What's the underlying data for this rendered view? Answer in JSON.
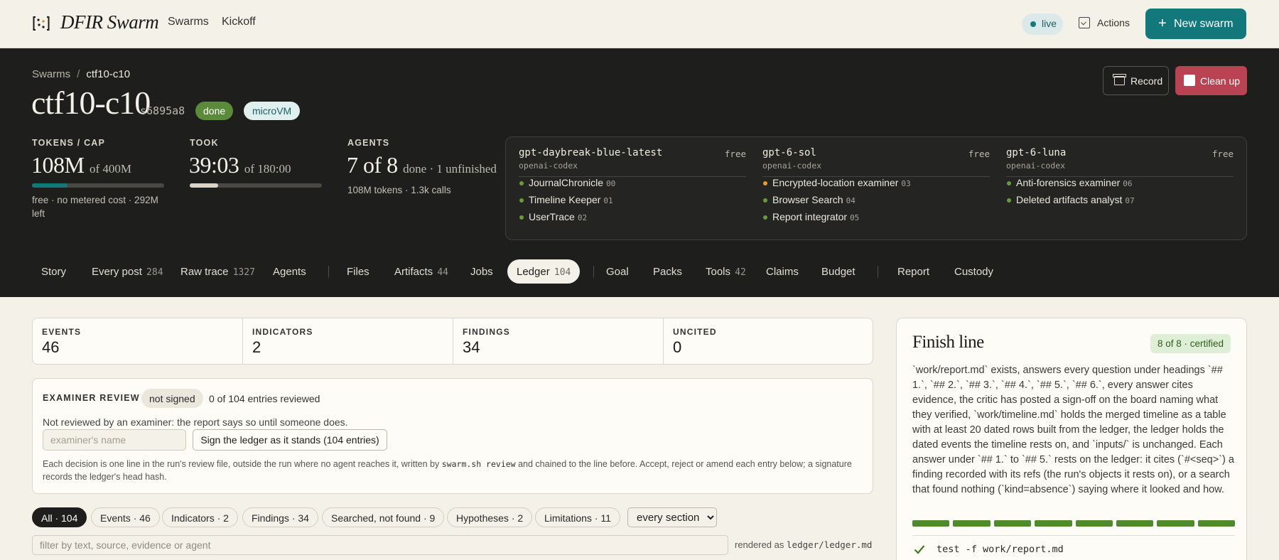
{
  "app": {
    "title": "DFIR Swarm",
    "nav": [
      "Swarms",
      "Kickoff"
    ],
    "status": "live",
    "actions_label": "Actions",
    "new_swarm_label": "New swarm",
    "accent_color": "#13787c"
  },
  "hero": {
    "breadcrumb": [
      "Swarms",
      "ctf10-c10"
    ],
    "title": "ctf10-c10",
    "id": "s6895a8",
    "badges": [
      "done",
      "microVM"
    ],
    "record_label": "Record",
    "cleanup_label": "Clean up",
    "stats": [
      {
        "label": "TOKENS / CAP",
        "value": "108M",
        "suffix": "of 400M",
        "progress": 0.27,
        "note": "free · no metered cost · 292M left"
      },
      {
        "label": "TOOK",
        "value": "39:03",
        "suffix": "of 180:00",
        "progress": 0.217
      },
      {
        "label": "AGENTS",
        "value": "7 of 8",
        "suffix": "done · 1 unfinished",
        "note": "108M tokens · 1.3k calls"
      }
    ],
    "models": [
      {
        "name": "gpt-daybreak-blue-latest",
        "provider": "openai-codex",
        "tier": "free",
        "agents": [
          {
            "name": "JournalChronicle",
            "num": "00",
            "status": "done"
          },
          {
            "name": "Timeline Keeper",
            "num": "01",
            "status": "done"
          },
          {
            "name": "UserTrace",
            "num": "02",
            "status": "done"
          }
        ]
      },
      {
        "name": "gpt-6-sol",
        "provider": "openai-codex",
        "tier": "free",
        "agents": [
          {
            "name": "Encrypted-location examiner",
            "num": "03",
            "status": "unfinished"
          },
          {
            "name": "Browser Search",
            "num": "04",
            "status": "done"
          },
          {
            "name": "Report integrator",
            "num": "05",
            "status": "done"
          }
        ]
      },
      {
        "name": "gpt-6-luna",
        "provider": "openai-codex",
        "tier": "free",
        "agents": [
          {
            "name": "Anti-forensics examiner",
            "num": "06",
            "status": "done"
          },
          {
            "name": "Deleted artifacts analyst",
            "num": "07",
            "status": "done"
          }
        ]
      }
    ],
    "status_colors": {
      "done": "#6a9a3e",
      "unfinished": "#e39a3b"
    }
  },
  "tabs": [
    {
      "label": "Story",
      "count": ""
    },
    {
      "label": "Every post",
      "count": "284"
    },
    {
      "label": "Raw trace",
      "count": "1327"
    },
    {
      "label": "Agents",
      "count": ""
    },
    {
      "label": "Files",
      "count": ""
    },
    {
      "label": "Artifacts",
      "count": "44"
    },
    {
      "label": "Jobs",
      "count": ""
    },
    {
      "label": "Ledger",
      "count": "104",
      "active": true
    },
    {
      "label": "Goal",
      "count": ""
    },
    {
      "label": "Packs",
      "count": ""
    },
    {
      "label": "Tools",
      "count": "42"
    },
    {
      "label": "Claims",
      "count": ""
    },
    {
      "label": "Budget",
      "count": ""
    },
    {
      "label": "Report",
      "count": ""
    },
    {
      "label": "Custody",
      "count": ""
    }
  ],
  "summary": [
    {
      "label": "EVENTS",
      "value": "46"
    },
    {
      "label": "INDICATORS",
      "value": "2"
    },
    {
      "label": "FINDINGS",
      "value": "34"
    },
    {
      "label": "UNCITED",
      "value": "0"
    }
  ],
  "review": {
    "label": "EXAMINER REVIEW",
    "status": "not signed",
    "count": "0 of 104 entries reviewed",
    "note": "Not reviewed by an examiner: the report says so until someone does.",
    "name_placeholder": "examiner's name",
    "sign_label": "Sign the ledger as it stands (104 entries)",
    "desc_a": "Each decision is one line in the run's review file, outside the run where no agent reaches it, written by",
    "desc_cmd": "swarm.sh review",
    "desc_b": "and chained to the line before. Accept, reject or amend each entry below; a signature records the ledger's head hash."
  },
  "filters": {
    "chips": [
      "All · 104",
      "Events · 46",
      "Indicators · 2",
      "Findings · 34",
      "Searched, not found · 9",
      "Hypotheses · 2",
      "Limitations · 11"
    ],
    "section": "every section",
    "search_placeholder": "filter by text, source, evidence or agent",
    "rendered_prefix": "rendered as",
    "rendered_path": "ledger/ledger.md"
  },
  "finish": {
    "title": "Finish line",
    "badge": "8 of 8 · certified",
    "text": "`work/report.md` exists, answers every question under headings `## 1.`, `## 2.`, `## 3.`, `## 4.`, `## 5.`, `## 6.`, every answer cites evidence, the critic has posted a sign-off on the board naming what they verified, `work/timeline.md` holds the merged timeline as a table with at least 20 dated rows built from the ledger, the ledger holds the dated events the timeline rests on, and `inputs/` is unchanged. Each answer under `## 1.` to `## 5.` rests on the ledger: it cites (`#<seq>`) a finding recorded with its refs (the run's objects it rests on), or a search that found nothing (`kind=absence`) saying where it looked and how.",
    "certified": 8,
    "total": 8,
    "segment_color": "#4e8a2e",
    "first_check": "test -f work/report.md"
  }
}
